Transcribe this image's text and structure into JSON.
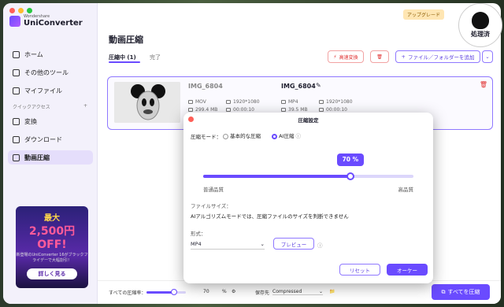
{
  "brand": {
    "small": "Wondershare",
    "name": "UniConverter"
  },
  "sidebar": {
    "items": [
      {
        "label": "ホーム",
        "icon": "home-icon"
      },
      {
        "label": "その他のツール",
        "icon": "tools-icon"
      },
      {
        "label": "マイファイル",
        "icon": "folder-icon"
      }
    ],
    "quick_access_label": "クイックアクセス",
    "quick_items": [
      {
        "label": "変換",
        "icon": "convert-icon"
      },
      {
        "label": "ダウンロード",
        "icon": "download-icon"
      },
      {
        "label": "動画圧縮",
        "icon": "compress-icon",
        "active": true
      }
    ],
    "promo": {
      "line1": "最大",
      "line2": "2,500円 OFF!",
      "line3": "新登場のUniConverter 16がブラックフライデーで大幅割引！",
      "button": "詳しく見る"
    }
  },
  "header": {
    "upgrade": "アップグレード",
    "badge_text": "処理済"
  },
  "page": {
    "title": "動画圧縮",
    "tabs": [
      {
        "label": "圧縮中 (1)"
      },
      {
        "label": "完了"
      }
    ],
    "high_speed": "高速変換",
    "add_files": "ファイル／フォルダーを追加"
  },
  "file": {
    "source_name": "IMG_6804",
    "source_format": "MOV",
    "source_size": "299.4 MB",
    "source_res": "1920*1080",
    "source_dur": "00:00:10",
    "target_name": "IMG_6804",
    "target_format": "MP4",
    "target_size": "39.5 MB",
    "target_res": "1920*1080",
    "target_dur": "00:00:10"
  },
  "dialog": {
    "title": "圧縮設定",
    "mode_label": "圧縮モード：",
    "mode_basic": "基本的な圧縮",
    "mode_ai": "AI圧縮",
    "percent": "70 %",
    "percent_value": 70,
    "low_label": "普通品質",
    "high_label": "高品質",
    "size_label": "ファイルサイズ：",
    "size_note": "AIアルゴリズムモードでは、圧縮ファイルのサイズを判断できません",
    "format_label": "形式：",
    "format_value": "MP4",
    "preview": "プレビュー",
    "reset": "リセット",
    "ok": "オーケー"
  },
  "bottom": {
    "all_rate_label": "すべての圧縮率：",
    "rate_value": "70",
    "rate_unit": "%",
    "rate_fraction": 0.7,
    "save_label": "保存先",
    "save_value": "Compressed",
    "compress_all": "すべてを圧縮"
  },
  "colors": {
    "accent": "#6a4bff",
    "danger": "#e03030"
  }
}
